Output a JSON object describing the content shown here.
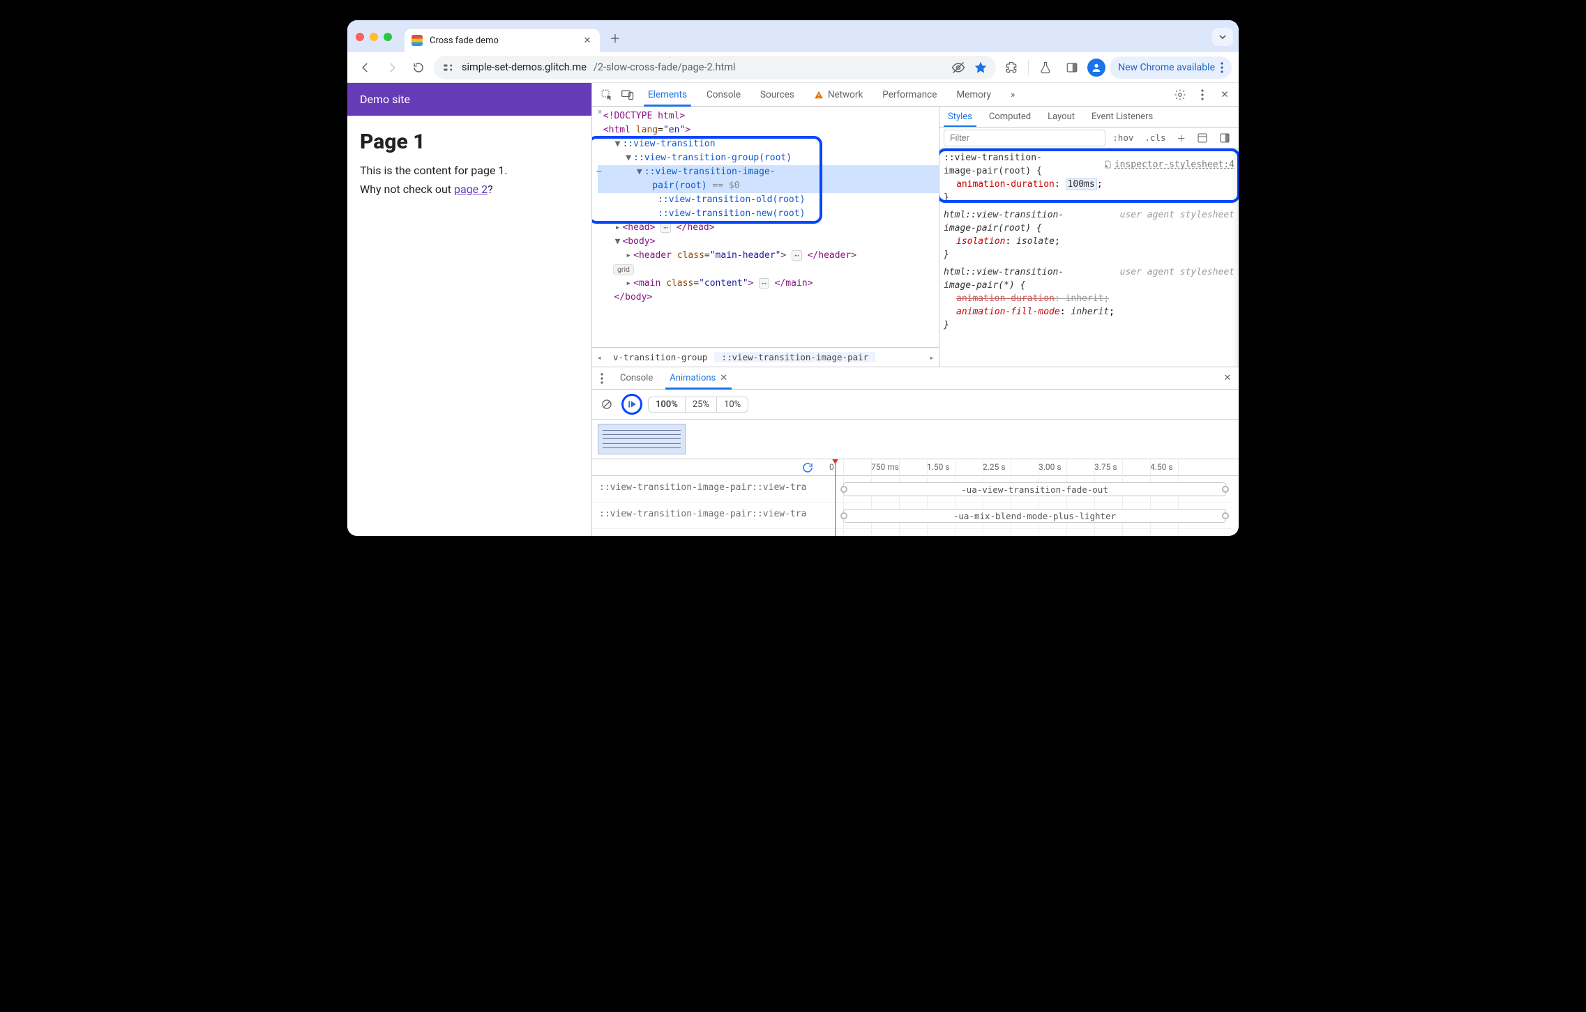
{
  "tab": {
    "title": "Cross fade demo"
  },
  "url": {
    "host": "simple-set-demos.glitch.me",
    "path": "/2-slow-cross-fade/page-2.html"
  },
  "chrome": {
    "update_label": "New Chrome available"
  },
  "page": {
    "site_title": "Demo site",
    "h1": "Page 1",
    "p1": "This is the content for page 1.",
    "p2_prefix": "Why not check out ",
    "p2_link": "page 2",
    "p2_suffix": "?"
  },
  "devtools": {
    "tabs": {
      "elements": "Elements",
      "console": "Console",
      "sources": "Sources",
      "network": "Network",
      "performance": "Performance",
      "memory": "Memory"
    },
    "elements": {
      "doctype": "<!DOCTYPE html>",
      "html_open": "html",
      "html_lang_attr": "lang",
      "html_lang_val": "en",
      "vt": "::view-transition",
      "vt_group": "::view-transition-group(root)",
      "vt_imgpair_a": "::view-transition-image-",
      "vt_imgpair_b": "pair(root)",
      "sel_badge": " == $0",
      "vt_old": "::view-transition-old(root)",
      "vt_new": "::view-transition-new(root)",
      "head": "head",
      "body": "body",
      "header_tag": "header",
      "header_class_attr": "class",
      "header_class_val": "main-header",
      "grid_chip": "grid",
      "main_tag": "main",
      "main_class_attr": "class",
      "main_class_val": "content",
      "crumb1": "v-transition-group",
      "crumb2": "::view-transition-image-pair"
    },
    "styles": {
      "tabs": {
        "styles": "Styles",
        "computed": "Computed",
        "layout": "Layout",
        "events": "Event Listeners"
      },
      "filter_placeholder": "Filter",
      "hov": ":hov",
      "cls": ".cls",
      "rule1": {
        "selector": "::view-transition-image-pair(root)",
        "src": "inspector-stylesheet:4",
        "prop": "animation-duration",
        "val": "100ms"
      },
      "rule2": {
        "selector": "html::view-transition-image-pair(root)",
        "src": "user agent stylesheet",
        "prop": "isolation",
        "val": "isolate"
      },
      "rule3": {
        "selector": "html::view-transition-image-pair(*)",
        "src": "user agent stylesheet",
        "prop1": "animation-duration",
        "val1": "inherit",
        "prop2": "animation-fill-mode",
        "val2": "inherit"
      }
    },
    "drawer": {
      "console": "Console",
      "animations": "Animations",
      "speeds": [
        "100%",
        "25%",
        "10%"
      ],
      "ruler": [
        "0",
        "750 ms",
        "1.50 s",
        "2.25 s",
        "3.00 s",
        "3.75 s",
        "4.50 s"
      ],
      "row1_left": "::view-transition-image-pair::view-tra",
      "row1_bar": "-ua-view-transition-fade-out",
      "row2_left": "::view-transition-image-pair::view-tra",
      "row2_bar": "-ua-mix-blend-mode-plus-lighter"
    }
  }
}
